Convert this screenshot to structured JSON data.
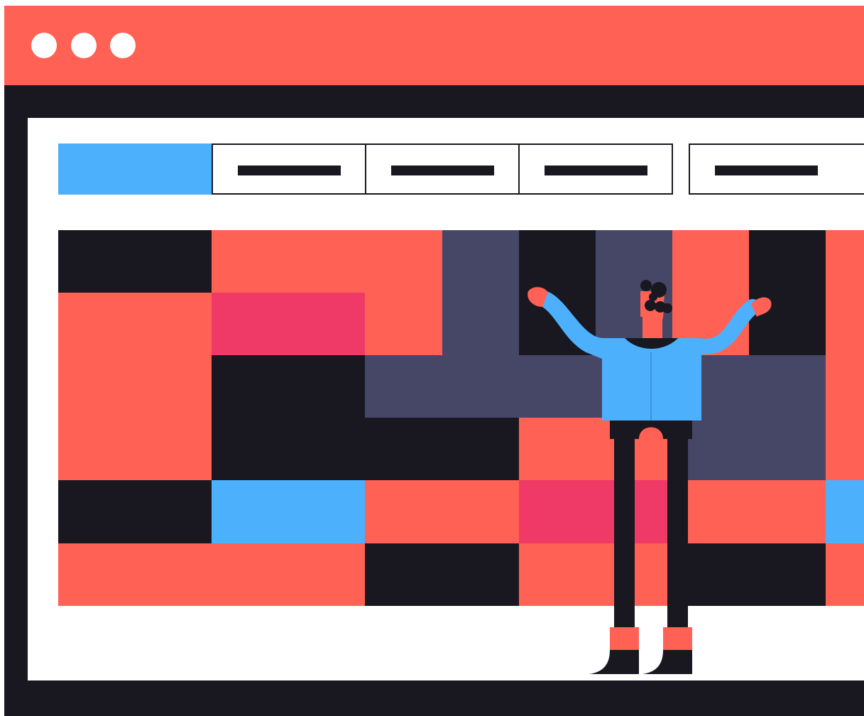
{
  "colors": {
    "titlebar": "#FF6155",
    "frame": "#191821",
    "content_bg": "#FFFFFF",
    "accent_blue": "#4DB0FD",
    "coral": "#FF6155",
    "pink": "#EF3A67",
    "slate": "#464766",
    "dark": "#191821"
  },
  "window": {
    "controls": [
      "window-dot",
      "window-dot",
      "window-dot"
    ]
  },
  "tabs": [
    {
      "state": "active"
    },
    {
      "state": "inactive"
    },
    {
      "state": "inactive"
    },
    {
      "state": "inactive"
    },
    {
      "state": "inactive"
    }
  ],
  "illustration": {
    "subject": "person-standing-arms-raised",
    "grid_rows": 6,
    "grid_columns": 6
  }
}
